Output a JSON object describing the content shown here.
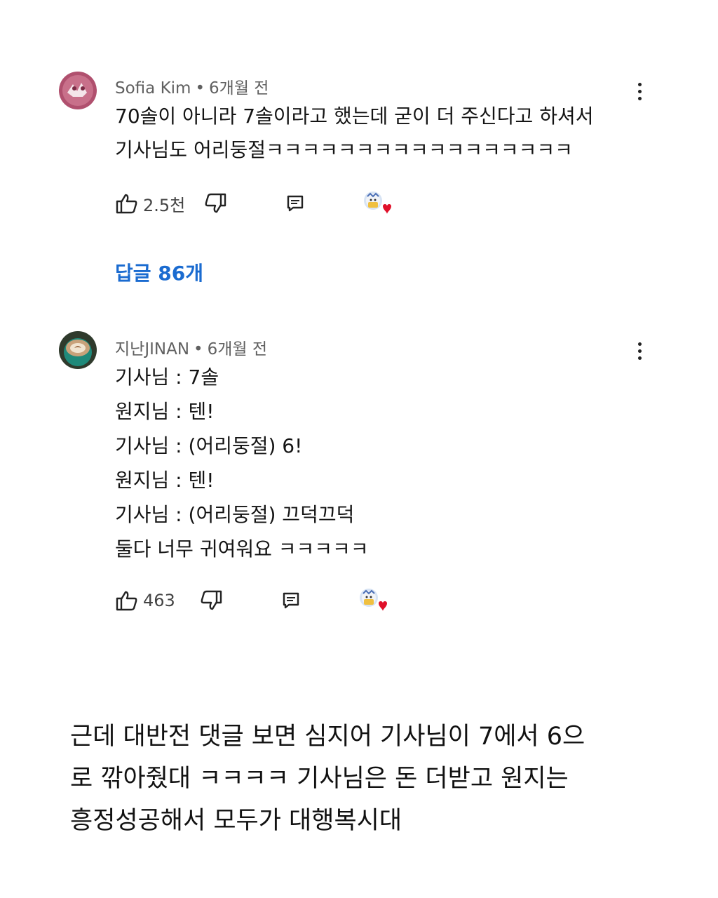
{
  "comments": [
    {
      "author": "Sofia Kim",
      "time": "6개월 전",
      "lines": [
        "70솔이 아니라 7솔이라고 했는데 굳이 더 주신다고 하셔서",
        "기사님도 어리둥절ㅋㅋㅋㅋㅋㅋㅋㅋㅋㅋㅋㅋㅋㅋㅋㅋㅋ"
      ],
      "likes": "2.5천",
      "replies_label": "답글 86개"
    },
    {
      "author": "지난JINAN",
      "time": "6개월 전",
      "lines": [
        "기사님 : 7솔",
        "원지님 : 텐!",
        "기사님 : (어리둥절) 6!",
        "원지님 : 텐!",
        "기사님 : (어리둥절) 끄덕끄덕",
        "둘다 너무 귀여워요 ㅋㅋㅋㅋㅋ"
      ],
      "likes": "463"
    }
  ],
  "post": {
    "lines": [
      "근데 대반전 댓글 보면 심지어 기사님이 7에서 6으",
      "로 깎아줬대 ㅋㅋㅋㅋ 기사님은 돈 더받고 원지는",
      "흥정성공해서 모두가 대행복시대"
    ]
  },
  "icons": {
    "like": "thumbs-up-icon",
    "dislike": "thumbs-down-icon",
    "reply": "reply-icon",
    "menu": "more-vert-icon",
    "creator_heart": "creator-heart-icon"
  },
  "colors": {
    "link": "#1a6bd0",
    "heart": "#e0102a",
    "meta": "#606060"
  }
}
